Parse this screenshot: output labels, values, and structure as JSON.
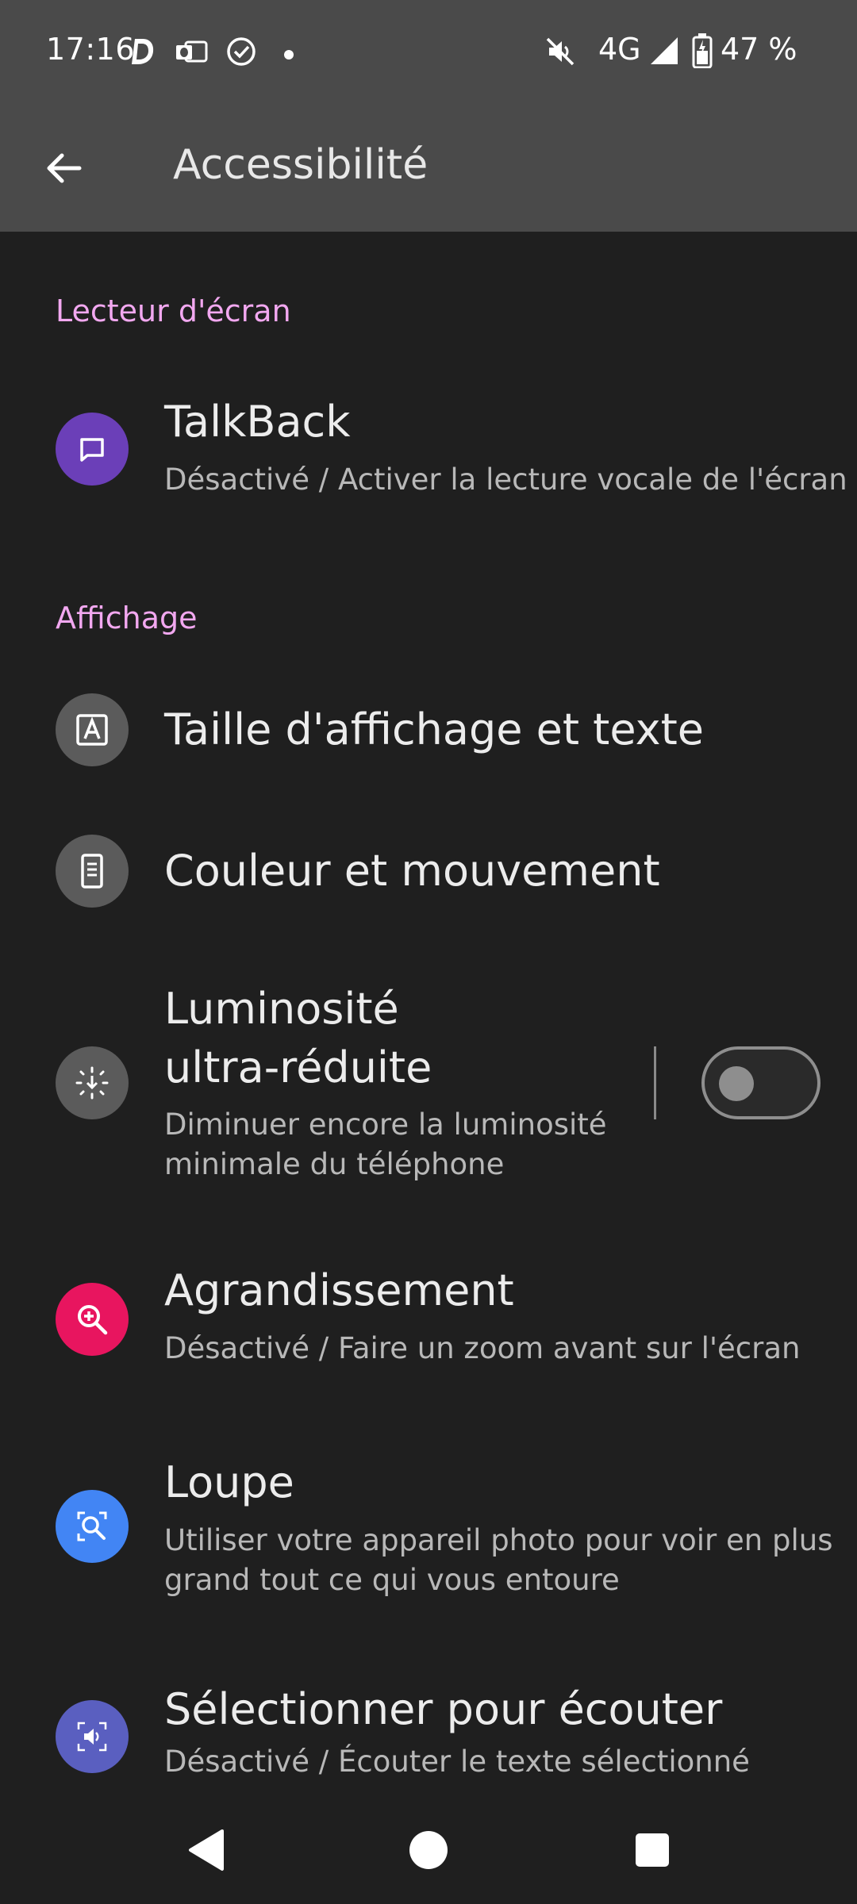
{
  "status_bar": {
    "time": "17:16",
    "network": "4G",
    "battery": "47 %"
  },
  "app_bar": {
    "title": "Accessibilité"
  },
  "sections": [
    {
      "title": "Lecteur d'écran",
      "items": [
        {
          "title": "TalkBack",
          "subtitle": "Désactivé / Activer la lecture vocale de l'écran",
          "icon": "chat-bubble-icon",
          "icon_color": "#6b3fb8"
        }
      ]
    },
    {
      "title": "Affichage",
      "items": [
        {
          "title": "Taille d'affichage et texte",
          "icon": "text-size-icon",
          "icon_color": "#5b5b5b"
        },
        {
          "title": "Couleur et mouvement",
          "icon": "phone-icon",
          "icon_color": "#5b5b5b"
        },
        {
          "title_line1": "Luminosité",
          "title_line2": "ultra-réduite",
          "subtitle_line1": "Diminuer encore la luminosité",
          "subtitle_line2": "minimale du téléphone",
          "icon": "brightness-low-icon",
          "icon_color": "#5b5b5b",
          "toggle_on": false
        },
        {
          "title": "Agrandissement",
          "subtitle": "Désactivé / Faire un zoom avant sur l'écran",
          "icon": "zoom-in-icon",
          "icon_color": "#e8155f"
        },
        {
          "title": "Loupe",
          "subtitle_line1": "Utiliser votre appareil photo pour voir en plus",
          "subtitle_line2": "grand tout ce qui vous entoure",
          "icon": "magnifier-camera-icon",
          "icon_color": "#4285f4"
        },
        {
          "title": "Sélectionner pour écouter",
          "subtitle": "Désactivé / Écouter le texte sélectionné",
          "icon": "select-to-speak-icon",
          "icon_color": "#5a5fc0"
        }
      ]
    }
  ],
  "nav_bar": {
    "back": "back-icon",
    "home": "home-icon",
    "recents": "recents-icon"
  }
}
